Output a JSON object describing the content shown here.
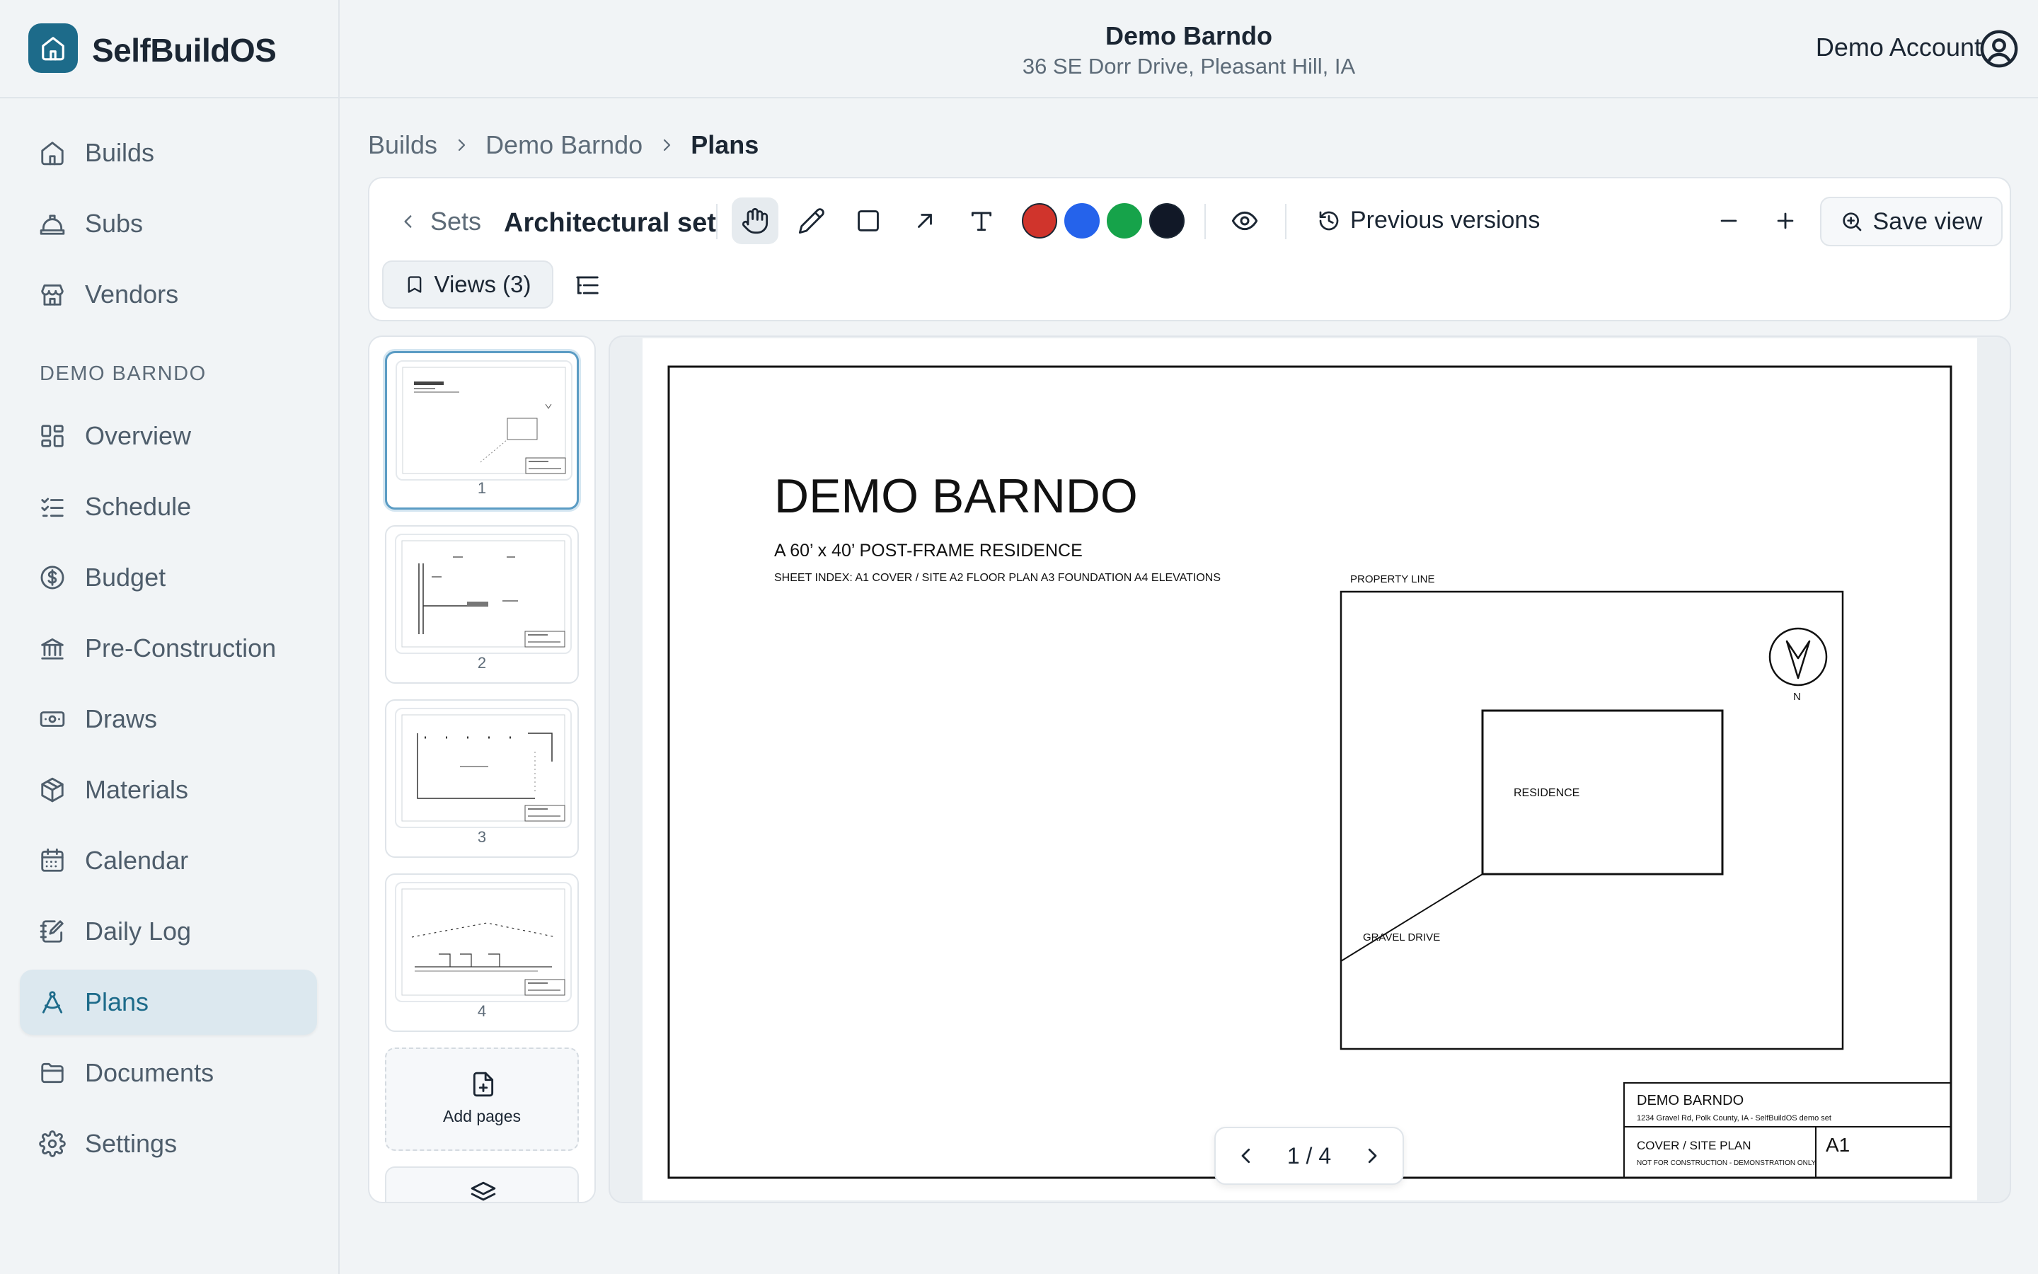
{
  "app": {
    "name": "SelfBuildOS",
    "accent": "#1d6b8a"
  },
  "header": {
    "project_title": "Demo Barndo",
    "project_address": "36 SE Dorr Drive, Pleasant Hill, IA",
    "account_label": "Demo Account"
  },
  "sidebar": {
    "global_items": [
      {
        "label": "Builds",
        "icon": "home-icon"
      },
      {
        "label": "Subs",
        "icon": "hard-hat-icon"
      },
      {
        "label": "Vendors",
        "icon": "store-icon"
      }
    ],
    "section_label": "DEMO BARNDO",
    "project_items": [
      {
        "label": "Overview",
        "icon": "grid-icon"
      },
      {
        "label": "Schedule",
        "icon": "checklist-icon"
      },
      {
        "label": "Budget",
        "icon": "dollar-icon"
      },
      {
        "label": "Pre-Construction",
        "icon": "bank-icon"
      },
      {
        "label": "Draws",
        "icon": "banknote-icon"
      },
      {
        "label": "Materials",
        "icon": "package-icon"
      },
      {
        "label": "Calendar",
        "icon": "calendar-icon"
      },
      {
        "label": "Daily Log",
        "icon": "notebook-pen-icon"
      },
      {
        "label": "Plans",
        "icon": "compass-drafting-icon",
        "active": true
      },
      {
        "label": "Documents",
        "icon": "folder-icon"
      },
      {
        "label": "Settings",
        "icon": "gear-icon"
      }
    ]
  },
  "breadcrumb": [
    "Builds",
    "Demo Barndo",
    "Plans"
  ],
  "toolbar": {
    "sets_label": "Sets",
    "set_name": "Architectural set",
    "tools": [
      "pan-hand-icon",
      "pencil-icon",
      "rectangle-icon",
      "arrow-icon",
      "text-icon"
    ],
    "active_tool": "pan-hand-icon",
    "colors": [
      "#d0342c",
      "#2563eb",
      "#16a34a",
      "#111827"
    ],
    "previous_versions_label": "Previous versions",
    "save_view_label": "Save view",
    "views_label": "Views (3)"
  },
  "thumbnails": {
    "pages": [
      "1",
      "2",
      "3",
      "4"
    ],
    "selected_page": "1",
    "add_pages_label": "Add pages"
  },
  "sheet": {
    "title": "DEMO BARNDO",
    "subtitle": "A 60’ x 40’ POST-FRAME RESIDENCE",
    "sheet_index": "SHEET INDEX:  A1 COVER / SITE    A2 FLOOR PLAN    A3 FOUNDATION    A4 ELEVATIONS",
    "property_line_label": "PROPERTY LINE",
    "residence_label": "RESIDENCE",
    "drive_label": "GRAVEL DRIVE",
    "north_label": "N",
    "title_block": {
      "project": "DEMO BARNDO",
      "address": "1234 Gravel Rd, Polk County, IA  -  SelfBuildOS demo set",
      "sheet_title": "COVER / SITE PLAN",
      "note": "NOT FOR CONSTRUCTION - DEMONSTRATION ONLY",
      "sheet_number": "A1"
    }
  },
  "pager": {
    "label": "1 / 4"
  }
}
